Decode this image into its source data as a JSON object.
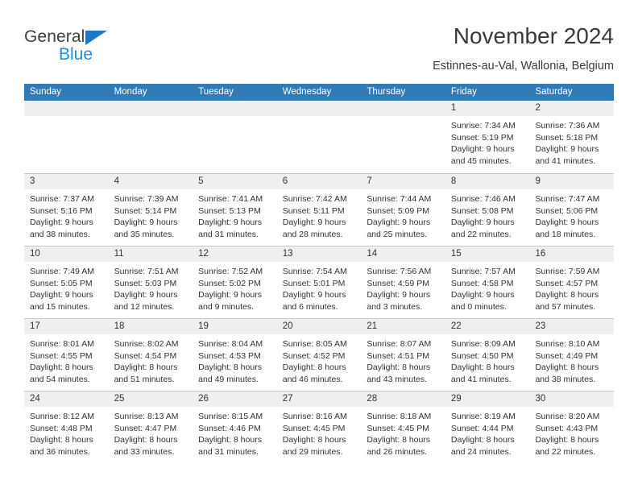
{
  "brand": {
    "word1": "General",
    "word2": "Blue",
    "triangle_color": "#1f77c2",
    "word2_color": "#1f8fe0"
  },
  "header": {
    "month_title": "November 2024",
    "location": "Estinnes-au-Val, Wallonia, Belgium"
  },
  "calendar": {
    "header_bg": "#3279b7",
    "date_strip_bg": "#efefef",
    "weekdays": [
      "Sunday",
      "Monday",
      "Tuesday",
      "Wednesday",
      "Thursday",
      "Friday",
      "Saturday"
    ],
    "weeks": [
      [
        {
          "date": "",
          "lines": []
        },
        {
          "date": "",
          "lines": []
        },
        {
          "date": "",
          "lines": []
        },
        {
          "date": "",
          "lines": []
        },
        {
          "date": "",
          "lines": []
        },
        {
          "date": "1",
          "lines": [
            "Sunrise: 7:34 AM",
            "Sunset: 5:19 PM",
            "Daylight: 9 hours",
            "and 45 minutes."
          ]
        },
        {
          "date": "2",
          "lines": [
            "Sunrise: 7:36 AM",
            "Sunset: 5:18 PM",
            "Daylight: 9 hours",
            "and 41 minutes."
          ]
        }
      ],
      [
        {
          "date": "3",
          "lines": [
            "Sunrise: 7:37 AM",
            "Sunset: 5:16 PM",
            "Daylight: 9 hours",
            "and 38 minutes."
          ]
        },
        {
          "date": "4",
          "lines": [
            "Sunrise: 7:39 AM",
            "Sunset: 5:14 PM",
            "Daylight: 9 hours",
            "and 35 minutes."
          ]
        },
        {
          "date": "5",
          "lines": [
            "Sunrise: 7:41 AM",
            "Sunset: 5:13 PM",
            "Daylight: 9 hours",
            "and 31 minutes."
          ]
        },
        {
          "date": "6",
          "lines": [
            "Sunrise: 7:42 AM",
            "Sunset: 5:11 PM",
            "Daylight: 9 hours",
            "and 28 minutes."
          ]
        },
        {
          "date": "7",
          "lines": [
            "Sunrise: 7:44 AM",
            "Sunset: 5:09 PM",
            "Daylight: 9 hours",
            "and 25 minutes."
          ]
        },
        {
          "date": "8",
          "lines": [
            "Sunrise: 7:46 AM",
            "Sunset: 5:08 PM",
            "Daylight: 9 hours",
            "and 22 minutes."
          ]
        },
        {
          "date": "9",
          "lines": [
            "Sunrise: 7:47 AM",
            "Sunset: 5:06 PM",
            "Daylight: 9 hours",
            "and 18 minutes."
          ]
        }
      ],
      [
        {
          "date": "10",
          "lines": [
            "Sunrise: 7:49 AM",
            "Sunset: 5:05 PM",
            "Daylight: 9 hours",
            "and 15 minutes."
          ]
        },
        {
          "date": "11",
          "lines": [
            "Sunrise: 7:51 AM",
            "Sunset: 5:03 PM",
            "Daylight: 9 hours",
            "and 12 minutes."
          ]
        },
        {
          "date": "12",
          "lines": [
            "Sunrise: 7:52 AM",
            "Sunset: 5:02 PM",
            "Daylight: 9 hours",
            "and 9 minutes."
          ]
        },
        {
          "date": "13",
          "lines": [
            "Sunrise: 7:54 AM",
            "Sunset: 5:01 PM",
            "Daylight: 9 hours",
            "and 6 minutes."
          ]
        },
        {
          "date": "14",
          "lines": [
            "Sunrise: 7:56 AM",
            "Sunset: 4:59 PM",
            "Daylight: 9 hours",
            "and 3 minutes."
          ]
        },
        {
          "date": "15",
          "lines": [
            "Sunrise: 7:57 AM",
            "Sunset: 4:58 PM",
            "Daylight: 9 hours",
            "and 0 minutes."
          ]
        },
        {
          "date": "16",
          "lines": [
            "Sunrise: 7:59 AM",
            "Sunset: 4:57 PM",
            "Daylight: 8 hours",
            "and 57 minutes."
          ]
        }
      ],
      [
        {
          "date": "17",
          "lines": [
            "Sunrise: 8:01 AM",
            "Sunset: 4:55 PM",
            "Daylight: 8 hours",
            "and 54 minutes."
          ]
        },
        {
          "date": "18",
          "lines": [
            "Sunrise: 8:02 AM",
            "Sunset: 4:54 PM",
            "Daylight: 8 hours",
            "and 51 minutes."
          ]
        },
        {
          "date": "19",
          "lines": [
            "Sunrise: 8:04 AM",
            "Sunset: 4:53 PM",
            "Daylight: 8 hours",
            "and 49 minutes."
          ]
        },
        {
          "date": "20",
          "lines": [
            "Sunrise: 8:05 AM",
            "Sunset: 4:52 PM",
            "Daylight: 8 hours",
            "and 46 minutes."
          ]
        },
        {
          "date": "21",
          "lines": [
            "Sunrise: 8:07 AM",
            "Sunset: 4:51 PM",
            "Daylight: 8 hours",
            "and 43 minutes."
          ]
        },
        {
          "date": "22",
          "lines": [
            "Sunrise: 8:09 AM",
            "Sunset: 4:50 PM",
            "Daylight: 8 hours",
            "and 41 minutes."
          ]
        },
        {
          "date": "23",
          "lines": [
            "Sunrise: 8:10 AM",
            "Sunset: 4:49 PM",
            "Daylight: 8 hours",
            "and 38 minutes."
          ]
        }
      ],
      [
        {
          "date": "24",
          "lines": [
            "Sunrise: 8:12 AM",
            "Sunset: 4:48 PM",
            "Daylight: 8 hours",
            "and 36 minutes."
          ]
        },
        {
          "date": "25",
          "lines": [
            "Sunrise: 8:13 AM",
            "Sunset: 4:47 PM",
            "Daylight: 8 hours",
            "and 33 minutes."
          ]
        },
        {
          "date": "26",
          "lines": [
            "Sunrise: 8:15 AM",
            "Sunset: 4:46 PM",
            "Daylight: 8 hours",
            "and 31 minutes."
          ]
        },
        {
          "date": "27",
          "lines": [
            "Sunrise: 8:16 AM",
            "Sunset: 4:45 PM",
            "Daylight: 8 hours",
            "and 29 minutes."
          ]
        },
        {
          "date": "28",
          "lines": [
            "Sunrise: 8:18 AM",
            "Sunset: 4:45 PM",
            "Daylight: 8 hours",
            "and 26 minutes."
          ]
        },
        {
          "date": "29",
          "lines": [
            "Sunrise: 8:19 AM",
            "Sunset: 4:44 PM",
            "Daylight: 8 hours",
            "and 24 minutes."
          ]
        },
        {
          "date": "30",
          "lines": [
            "Sunrise: 8:20 AM",
            "Sunset: 4:43 PM",
            "Daylight: 8 hours",
            "and 22 minutes."
          ]
        }
      ]
    ]
  }
}
